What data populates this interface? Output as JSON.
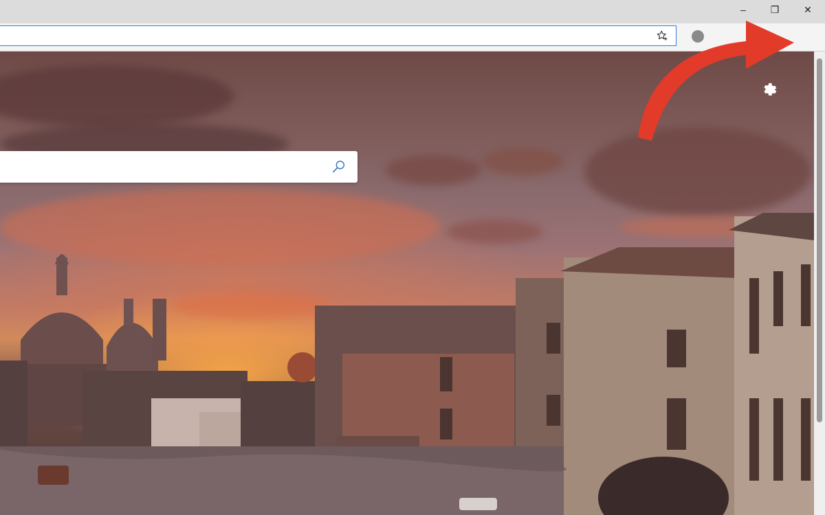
{
  "window_controls": {
    "minimize": "–",
    "restore": "❐",
    "close": "✕"
  },
  "toolbar": {
    "address_value": "",
    "favorite_icon": "star-plus-icon",
    "more_label": "···"
  },
  "page": {
    "search_placeholder": "",
    "search_icon": "search-icon",
    "settings_icon": "gear-icon"
  },
  "annotation": {
    "arrow_color": "#e33b2a"
  }
}
